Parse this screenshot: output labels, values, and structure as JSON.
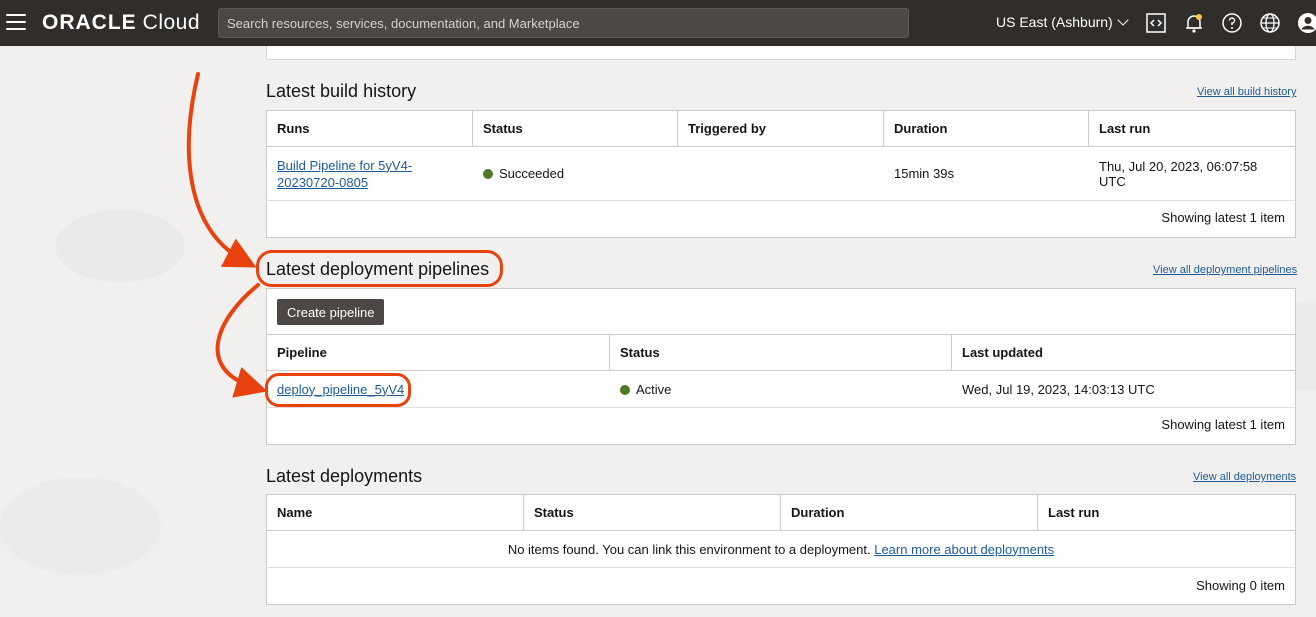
{
  "header": {
    "brand": "ORACLE",
    "product": "Cloud",
    "search_placeholder": "Search resources, services, documentation, and Marketplace",
    "region": "US East (Ashburn)",
    "icons": [
      "menu-icon",
      "code-editor-icon",
      "bell-icon",
      "help-icon",
      "globe-icon",
      "user-icon"
    ]
  },
  "build_history": {
    "title": "Latest build history",
    "view_all": "View all build history",
    "columns": [
      "Runs",
      "Status",
      "Triggered by",
      "Duration",
      "Last run"
    ],
    "rows": [
      {
        "run": "Build Pipeline for 5yV4-20230720-0805",
        "status": "Succeeded",
        "triggered_by": "",
        "duration": "15min 39s",
        "last_run": "Thu, Jul 20, 2023, 06:07:58 UTC"
      }
    ],
    "footer": "Showing latest 1 item"
  },
  "deployment_pipelines": {
    "title": "Latest deployment pipelines",
    "view_all": "View all deployment pipelines",
    "create_button": "Create pipeline",
    "columns": [
      "Pipeline",
      "Status",
      "Last updated"
    ],
    "rows": [
      {
        "pipeline": "deploy_pipeline_5yV4",
        "status": "Active",
        "last_updated": "Wed, Jul 19, 2023, 14:03:13 UTC"
      }
    ],
    "footer": "Showing latest 1 item"
  },
  "deployments": {
    "title": "Latest deployments",
    "view_all": "View all deployments",
    "columns": [
      "Name",
      "Status",
      "Duration",
      "Last run"
    ],
    "empty_text": "No items found. You can link this environment to a deployment.",
    "empty_link": "Learn more about deployments",
    "footer": "Showing 0 item"
  },
  "colors": {
    "header_bg": "#312d2a",
    "link": "#1e5b9a",
    "status_green": "#4e7a27",
    "annotation": "#e8420f",
    "button_bg": "#4d4845"
  }
}
